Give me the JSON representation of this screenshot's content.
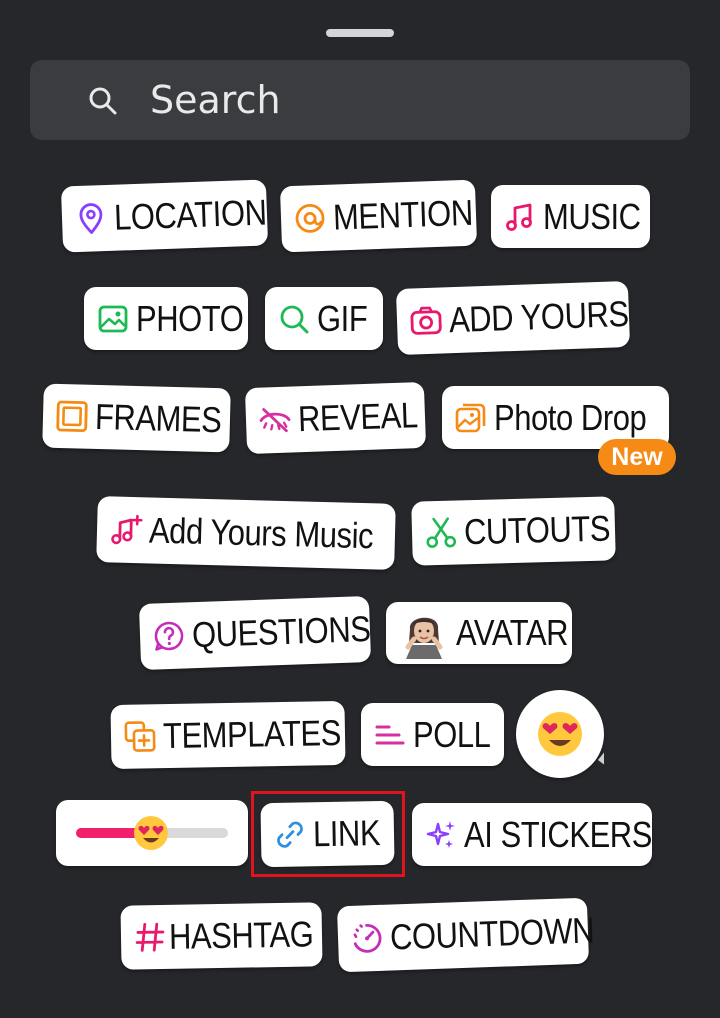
{
  "search": {
    "placeholder": "Search"
  },
  "stickers": {
    "location": "LOCATION",
    "mention": "MENTION",
    "music": "MUSIC",
    "photo": "PHOTO",
    "gif": "GIF",
    "add_yours": "ADD YOURS",
    "frames": "FRAMES",
    "reveal": "REVEAL",
    "photo_drop": "Photo Drop",
    "photo_drop_badge": "New",
    "add_yours_music": "Add Yours Music",
    "cutouts": "CUTOUTS",
    "questions": "QUESTIONS",
    "avatar": "AVATAR",
    "templates": "TEMPLATES",
    "poll": "POLL",
    "link": "LINK",
    "ai_stickers": "AI STICKERS",
    "hashtag": "HASHTAG",
    "countdown": "COUNTDOWN"
  },
  "emoji_slider": {
    "value": 0.45,
    "emoji": "heart-eyes"
  },
  "icons": {
    "search": "search-icon",
    "location": "location-pin-icon",
    "mention": "threads-at-icon",
    "music": "music-note-icon",
    "photo": "image-icon",
    "gif": "search-icon",
    "add_yours": "camera-icon",
    "frames": "frame-icon",
    "reveal": "eye-slash-icon",
    "photo_drop": "photo-drop-icon",
    "add_yours_music": "music-plus-icon",
    "cutouts": "scissors-icon",
    "questions": "question-bubble-icon",
    "avatar": "avatar-image",
    "templates": "template-plus-icon",
    "poll": "poll-lines-icon",
    "link": "link-icon",
    "ai_stickers": "sparkle-icon",
    "hashtag": "hashtag-icon",
    "countdown": "countdown-timer-icon"
  },
  "colors": {
    "background": "#26272b",
    "search_bg": "#3b3c40",
    "location": "#8a3ffc",
    "mention": "#f58a14",
    "music": "#e8196d",
    "photo": "#1db954",
    "gif": "#1db954",
    "add_yours": "#e8196d",
    "frames": "#f58a14",
    "reveal": "#d62fa0",
    "photo_drop": "#f58a14",
    "cutouts": "#1db954",
    "questions": "#c52db8",
    "templates": "#f58a14",
    "poll": "#d62fa0",
    "link": "#2e8fe0",
    "ai_stickers": "#8a3ffc",
    "hashtag": "#e8196d",
    "countdown": "#c52db8",
    "badge": "#f58a14",
    "highlight": "#e0141e"
  }
}
